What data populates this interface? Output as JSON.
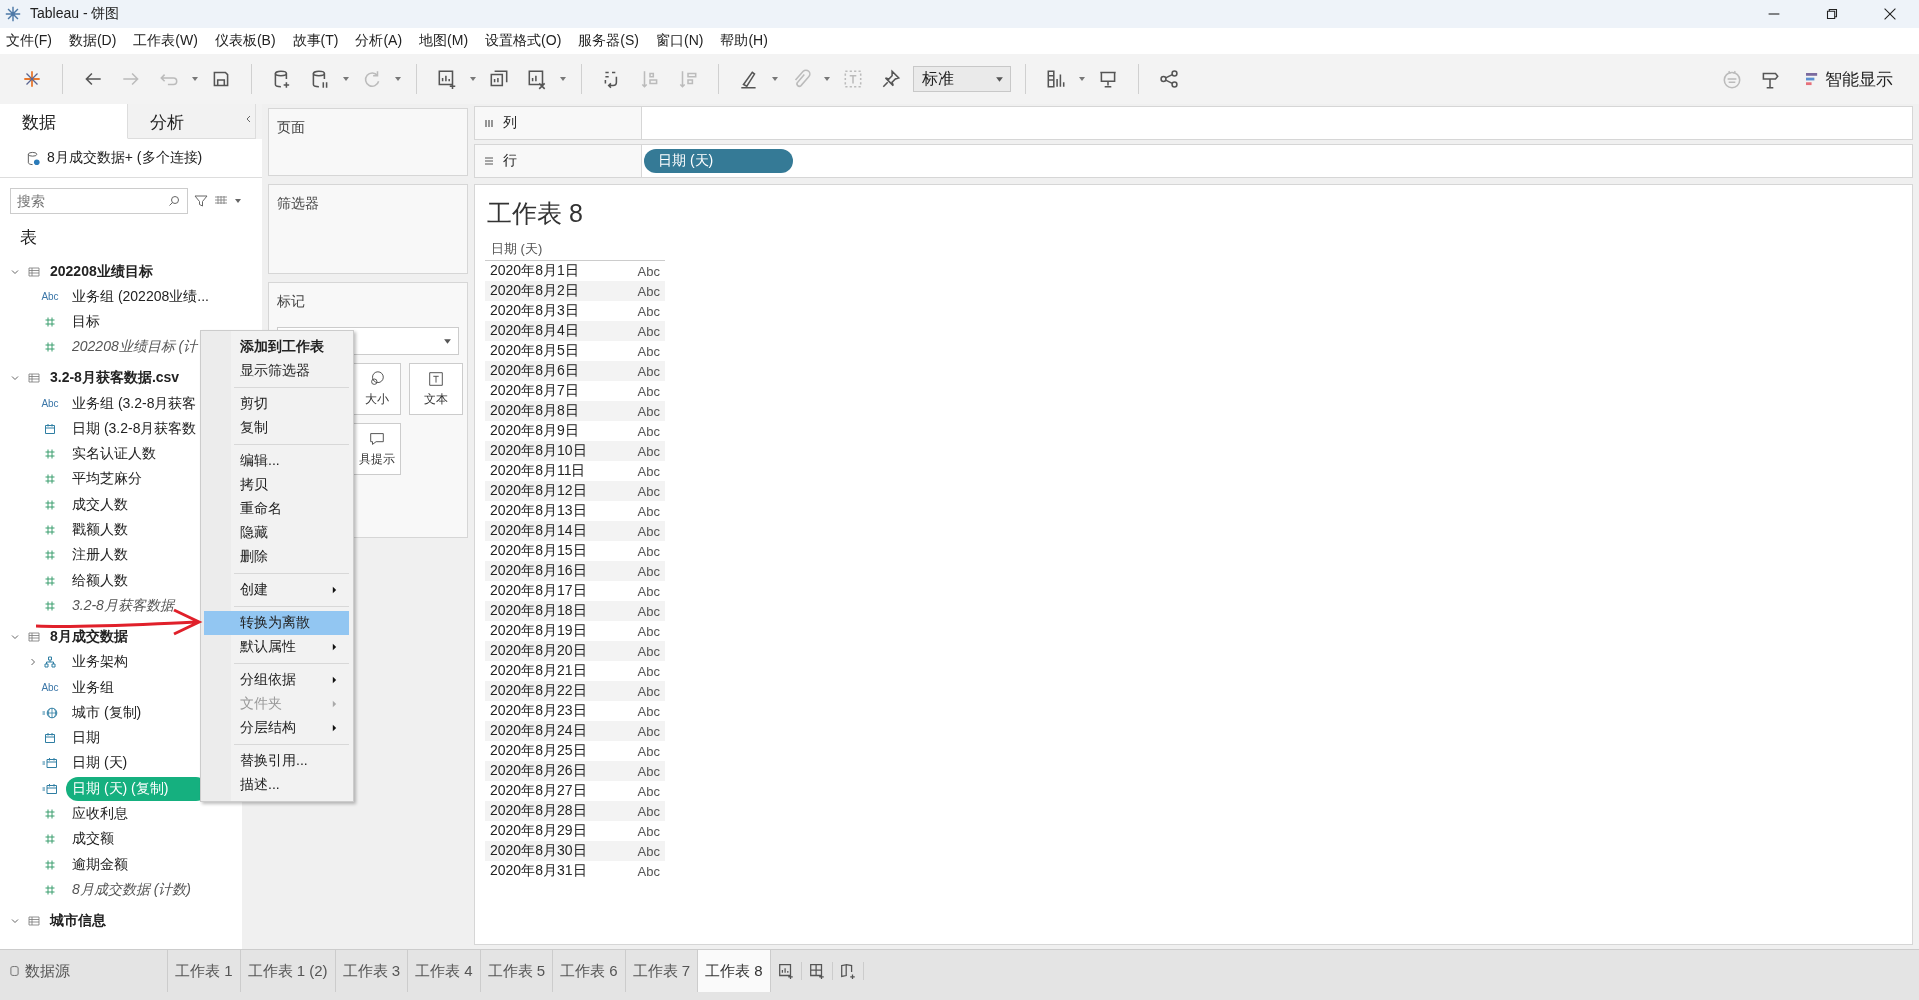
{
  "window": {
    "title": "Tableau - 饼图"
  },
  "menu": [
    "文件(F)",
    "数据(D)",
    "工作表(W)",
    "仪表板(B)",
    "故事(T)",
    "分析(A)",
    "地图(M)",
    "设置格式(O)",
    "服务器(S)",
    "窗口(N)",
    "帮助(H)"
  ],
  "toolbar": {
    "mark_type": "标准",
    "show_me": "智能显示"
  },
  "data_pane": {
    "tabs": [
      {
        "label": "数据",
        "selected": true
      },
      {
        "label": "分析",
        "selected": false
      }
    ],
    "datasource": "8月成交数据+ (多个连接)",
    "search": {
      "placeholder": "搜索"
    },
    "tables_heading": "表",
    "tables": [
      {
        "name": "202208业绩目标",
        "expanded": true,
        "children": [
          {
            "kind": "abc",
            "type_label": "Abc",
            "label": "业务组 (202208业绩...",
            "italic": false,
            "selected": false
          },
          {
            "kind": "number",
            "label": "目标",
            "italic": false,
            "selected": false
          },
          {
            "kind": "number",
            "label": "202208业绩目标 (计",
            "italic": true,
            "selected": false
          }
        ]
      },
      {
        "name": "3.2-8月获客数据.csv",
        "expanded": true,
        "children": [
          {
            "kind": "abc",
            "type_label": "Abc",
            "label": "业务组 (3.2-8月获客",
            "italic": false,
            "selected": false
          },
          {
            "kind": "date",
            "label": "日期 (3.2-8月获客数",
            "italic": false,
            "selected": false
          },
          {
            "kind": "number",
            "label": "实名认证人数",
            "italic": false,
            "selected": false
          },
          {
            "kind": "number",
            "label": "平均芝麻分",
            "italic": false,
            "selected": false
          },
          {
            "kind": "number",
            "label": "成交人数",
            "italic": false,
            "selected": false
          },
          {
            "kind": "number",
            "label": "戳额人数",
            "italic": false,
            "selected": false
          },
          {
            "kind": "number",
            "label": "注册人数",
            "italic": false,
            "selected": false
          },
          {
            "kind": "number",
            "label": "给额人数",
            "italic": false,
            "selected": false
          },
          {
            "kind": "number",
            "label": "3.2-8月获客数据",
            "italic": true,
            "selected": false
          }
        ]
      },
      {
        "name": "8月成交数据",
        "expanded": true,
        "children": [
          {
            "kind": "hierarchy",
            "label": "业务架构",
            "expanded": false,
            "italic": false,
            "selected": false
          },
          {
            "kind": "abc",
            "type_label": "Abc",
            "label": "业务组",
            "italic": false,
            "selected": false
          },
          {
            "kind": "geo",
            "label": "城市 (复制)",
            "italic": false,
            "selected": false
          },
          {
            "kind": "date",
            "label": "日期",
            "italic": false,
            "selected": false
          },
          {
            "kind": "date-calc",
            "label": "日期 (天)",
            "italic": false,
            "selected": false
          },
          {
            "kind": "date-calc",
            "label": "日期 (天) (复制)",
            "italic": false,
            "selected": true
          },
          {
            "kind": "number",
            "label": "应收利息",
            "italic": false,
            "selected": false
          },
          {
            "kind": "number",
            "label": "成交额",
            "italic": false,
            "selected": false
          },
          {
            "kind": "number",
            "label": "逾期金额",
            "italic": false,
            "selected": false
          },
          {
            "kind": "number",
            "label": "8月成交数据 (计数)",
            "italic": true,
            "selected": false
          }
        ]
      },
      {
        "name": "城市信息",
        "expanded": true
      }
    ]
  },
  "shelves": {
    "pages": "页面",
    "filters": "筛选器",
    "marks": {
      "label": "标记",
      "buttons": [
        "大小",
        "文本",
        "具提示"
      ]
    },
    "columns": {
      "label": "列"
    },
    "rows": {
      "label": "行",
      "pills": [
        "日期 (天)"
      ]
    }
  },
  "context_menu": [
    [
      {
        "label": "添加到工作表",
        "default": true,
        "submenu": false,
        "disabled": false,
        "selected": false
      },
      {
        "label": "显示筛选器",
        "default": false,
        "submenu": false,
        "disabled": false,
        "selected": false
      }
    ],
    [
      {
        "label": "剪切",
        "default": false,
        "submenu": false,
        "disabled": false,
        "selected": false
      },
      {
        "label": "复制",
        "default": false,
        "submenu": false,
        "disabled": false,
        "selected": false
      }
    ],
    [
      {
        "label": "编辑...",
        "default": false,
        "submenu": false,
        "disabled": false,
        "selected": false
      },
      {
        "label": "拷贝",
        "default": false,
        "submenu": false,
        "disabled": false,
        "selected": false
      },
      {
        "label": "重命名",
        "default": false,
        "submenu": false,
        "disabled": false,
        "selected": false
      },
      {
        "label": "隐藏",
        "default": false,
        "submenu": false,
        "disabled": false,
        "selected": false
      },
      {
        "label": "删除",
        "default": false,
        "submenu": false,
        "disabled": false,
        "selected": false
      }
    ],
    [
      {
        "label": "创建",
        "default": false,
        "submenu": true,
        "disabled": false,
        "selected": false
      }
    ],
    [
      {
        "label": "转换为离散",
        "default": false,
        "submenu": false,
        "disabled": false,
        "selected": true
      },
      {
        "label": "默认属性",
        "default": false,
        "submenu": true,
        "disabled": false,
        "selected": false
      }
    ],
    [
      {
        "label": "分组依据",
        "default": false,
        "submenu": true,
        "disabled": false,
        "selected": false
      },
      {
        "label": "文件夹",
        "default": false,
        "submenu": true,
        "disabled": true,
        "selected": false
      },
      {
        "label": "分层结构",
        "default": false,
        "submenu": true,
        "disabled": false,
        "selected": false
      }
    ],
    [
      {
        "label": "替换引用...",
        "default": false,
        "submenu": false,
        "disabled": false,
        "selected": false
      },
      {
        "label": "描述...",
        "default": false,
        "submenu": false,
        "disabled": false,
        "selected": false
      }
    ]
  ],
  "view": {
    "title": "工作表 8",
    "header": "日期 (天)",
    "rows": [
      {
        "date": "2020年8月1日",
        "value": "Abc"
      },
      {
        "date": "2020年8月2日",
        "value": "Abc"
      },
      {
        "date": "2020年8月3日",
        "value": "Abc"
      },
      {
        "date": "2020年8月4日",
        "value": "Abc"
      },
      {
        "date": "2020年8月5日",
        "value": "Abc"
      },
      {
        "date": "2020年8月6日",
        "value": "Abc"
      },
      {
        "date": "2020年8月7日",
        "value": "Abc"
      },
      {
        "date": "2020年8月8日",
        "value": "Abc"
      },
      {
        "date": "2020年8月9日",
        "value": "Abc"
      },
      {
        "date": "2020年8月10日",
        "value": "Abc"
      },
      {
        "date": "2020年8月11日",
        "value": "Abc"
      },
      {
        "date": "2020年8月12日",
        "value": "Abc"
      },
      {
        "date": "2020年8月13日",
        "value": "Abc"
      },
      {
        "date": "2020年8月14日",
        "value": "Abc"
      },
      {
        "date": "2020年8月15日",
        "value": "Abc"
      },
      {
        "date": "2020年8月16日",
        "value": "Abc"
      },
      {
        "date": "2020年8月17日",
        "value": "Abc"
      },
      {
        "date": "2020年8月18日",
        "value": "Abc"
      },
      {
        "date": "2020年8月19日",
        "value": "Abc"
      },
      {
        "date": "2020年8月20日",
        "value": "Abc"
      },
      {
        "date": "2020年8月21日",
        "value": "Abc"
      },
      {
        "date": "2020年8月22日",
        "value": "Abc"
      },
      {
        "date": "2020年8月23日",
        "value": "Abc"
      },
      {
        "date": "2020年8月24日",
        "value": "Abc"
      },
      {
        "date": "2020年8月25日",
        "value": "Abc"
      },
      {
        "date": "2020年8月26日",
        "value": "Abc"
      },
      {
        "date": "2020年8月27日",
        "value": "Abc"
      },
      {
        "date": "2020年8月28日",
        "value": "Abc"
      },
      {
        "date": "2020年8月29日",
        "value": "Abc"
      },
      {
        "date": "2020年8月30日",
        "value": "Abc"
      },
      {
        "date": "2020年8月31日",
        "value": "Abc"
      }
    ]
  },
  "sheet_tabs": [
    {
      "kind": "datasource",
      "label": "数据源",
      "selected": false
    },
    {
      "kind": "sheet",
      "label": "工作表 1",
      "selected": false
    },
    {
      "kind": "sheet",
      "label": "工作表 1 (2)",
      "selected": false
    },
    {
      "kind": "sheet",
      "label": "工作表 3",
      "selected": false
    },
    {
      "kind": "sheet",
      "label": "工作表 4",
      "selected": false
    },
    {
      "kind": "sheet",
      "label": "工作表 5",
      "selected": false
    },
    {
      "kind": "sheet",
      "label": "工作表 6",
      "selected": false
    },
    {
      "kind": "sheet",
      "label": "工作表 7",
      "selected": false
    },
    {
      "kind": "sheet",
      "label": "工作表 8",
      "selected": true
    }
  ]
}
